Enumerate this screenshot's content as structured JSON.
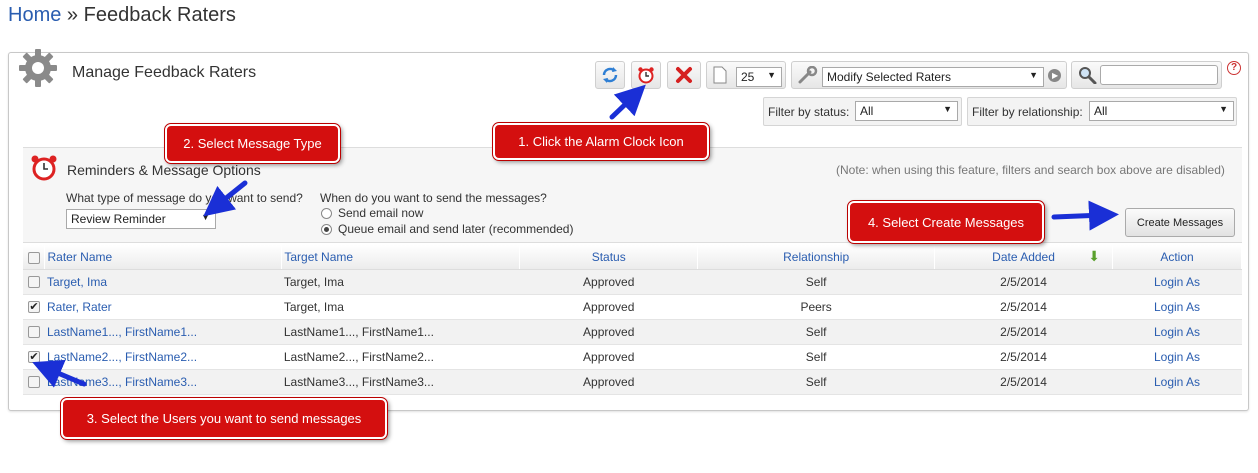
{
  "breadcrumb": {
    "home": "Home",
    "separator": " » ",
    "current": "Feedback Raters"
  },
  "panel": {
    "title": "Manage Feedback Raters"
  },
  "toolbar": {
    "page_size": "25",
    "action_select": "Modify Selected Raters",
    "search_value": ""
  },
  "filters": {
    "status_label": "Filter by status:",
    "status_value": "All",
    "relationship_label": "Filter by relationship:",
    "relationship_value": "All"
  },
  "reminders": {
    "title": "Reminders & Message Options",
    "note": "(Note: when using this feature, filters and search box above are disabled)",
    "type_question": "What type of message do you want to send?",
    "type_value": "Review Reminder",
    "when_question": "When do you want to send the messages?",
    "option_now": "Send email now",
    "option_later": "Queue email and send later (recommended)",
    "create_button": "Create Messages"
  },
  "table": {
    "headers": [
      "Rater Name",
      "Target Name",
      "Status",
      "Relationship",
      "Date Added",
      "Action"
    ],
    "rows": [
      {
        "checked": false,
        "rater": "Target, Ima",
        "target": "Target, Ima",
        "status": "Approved",
        "relationship": "Self",
        "date": "2/5/2014",
        "action": "Login As"
      },
      {
        "checked": true,
        "rater": "Rater, Rater",
        "target": "Target, Ima",
        "status": "Approved",
        "relationship": "Peers",
        "date": "2/5/2014",
        "action": "Login As"
      },
      {
        "checked": false,
        "rater": "LastName1..., FirstName1...",
        "target": "LastName1..., FirstName1...",
        "status": "Approved",
        "relationship": "Self",
        "date": "2/5/2014",
        "action": "Login As"
      },
      {
        "checked": true,
        "rater": "LastName2..., FirstName2...",
        "target": "LastName2..., FirstName2...",
        "status": "Approved",
        "relationship": "Self",
        "date": "2/5/2014",
        "action": "Login As"
      },
      {
        "checked": false,
        "rater": "LastName3..., FirstName3...",
        "target": "LastName3..., FirstName3...",
        "status": "Approved",
        "relationship": "Self",
        "date": "2/5/2014",
        "action": "Login As"
      }
    ]
  },
  "callouts": {
    "step1": "1. Click the Alarm Clock Icon",
    "step2": "2. Select Message Type",
    "step3": "3. Select the Users you want to send messages",
    "step4": "4. Select Create Messages"
  },
  "colors": {
    "link": "#2a5db0",
    "callout": "#d40f0f",
    "arrow": "#1a2fd6"
  }
}
